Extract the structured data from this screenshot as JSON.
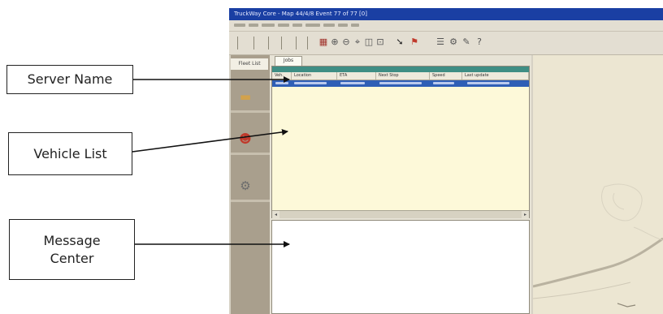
{
  "callouts": {
    "server_name": "Server Name",
    "vehicle_list": "Vehicle List",
    "message_center": "Message\nCenter"
  },
  "app": {
    "title": "TruckWay Core - Map 44/4/8 Event 77 of 77 [0]",
    "nav_tab": "Fleet List",
    "main_tab": "Jobs",
    "columns": [
      "Veh.",
      "Location",
      "ETA",
      "Next Stop",
      "Speed",
      "Last update"
    ]
  },
  "colors": {
    "title_bar": "#1a3fa3",
    "server_bar": "#3f8e84",
    "selected_row": "#2f5fb6",
    "vehicle_list_bg": "#fdf9d9",
    "map_bg": "#ece6d2",
    "nav_strip": "#a99f8d"
  },
  "icons": [
    "truck-icon",
    "people-icon",
    "gear-icon",
    "map-icon",
    "zoom-in-icon",
    "zoom-out-icon",
    "pointer-icon",
    "flag-icon",
    "help-icon"
  ]
}
